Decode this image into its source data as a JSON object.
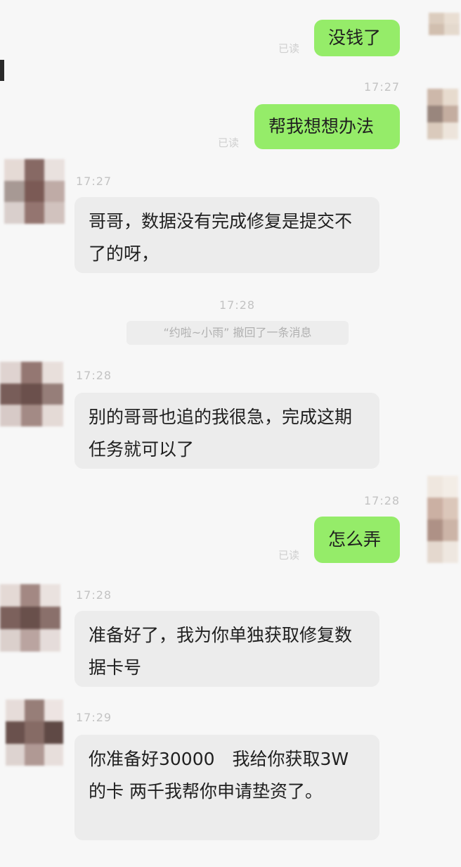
{
  "messages": [
    {
      "id": "m1",
      "side": "out",
      "text": "没钱了",
      "read": "已读"
    },
    {
      "id": "m2",
      "side": "out",
      "time": "17:27",
      "text": "帮我想想办法",
      "read": "已读"
    },
    {
      "id": "m3",
      "side": "in",
      "time": "17:27",
      "text": "哥哥，数据没有完成修复是提交不了的呀，"
    },
    {
      "id": "m4",
      "side": "system",
      "time": "17:28",
      "text": "“约啦~小雨” 撤回了一条消息"
    },
    {
      "id": "m5",
      "side": "in",
      "time": "17:28",
      "text": "别的哥哥也追的我很急，完成这期任务就可以了"
    },
    {
      "id": "m6",
      "side": "out",
      "time": "17:28",
      "text": "怎么弄",
      "read": "已读"
    },
    {
      "id": "m7",
      "side": "in",
      "time": "17:28",
      "text": "准备好了，我为你单独获取修复数据卡号"
    },
    {
      "id": "m8",
      "side": "in",
      "time": "17:29",
      "text": "你准备好30000　我给你获取3W 的卡 两千我帮你申请垫资了。"
    }
  ],
  "colors": {
    "outgoing_bubble": "#95ec69",
    "incoming_bubble": "#ececec",
    "background": "#f7f7f7"
  },
  "icons": {
    "avatar_left": "pixelated-avatar-icon",
    "avatar_right": "pixelated-avatar-icon"
  }
}
